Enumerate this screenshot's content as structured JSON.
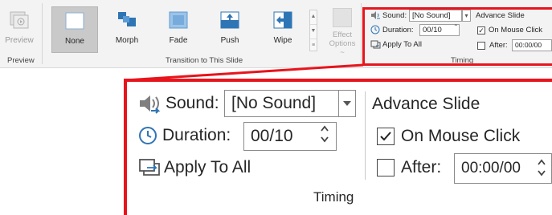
{
  "ribbon": {
    "preview": {
      "button_label": "Preview",
      "group_label": "Preview"
    },
    "transitions": [
      {
        "label": "None",
        "selected": true
      },
      {
        "label": "Morph"
      },
      {
        "label": "Fade"
      },
      {
        "label": "Push"
      },
      {
        "label": "Wipe"
      }
    ],
    "effect_options": {
      "line1": "Effect",
      "line2": "Options ~"
    },
    "transition_group_label": "Transition to This Slide",
    "timing": {
      "sound_label": "Sound:",
      "sound_value": "[No Sound]",
      "duration_label": "Duration:",
      "duration_value": "00/10",
      "apply_to_all": "Apply To All",
      "advance_slide": "Advance Slide",
      "on_mouse_click": "On Mouse Click",
      "on_mouse_click_checked": true,
      "after_label": "After:",
      "after_value": "00:00/00",
      "after_checked": false,
      "group_label": "Timing"
    }
  },
  "zoom": {
    "sound_label": "Sound:",
    "sound_value": "[No Sound]",
    "duration_label": "Duration:",
    "duration_value": "00/10",
    "apply_to_all": "Apply To All",
    "advance_slide": "Advance Slide",
    "on_mouse_click": "On Mouse Click",
    "on_mouse_click_checked": true,
    "after_label": "After:",
    "after_value": "00:00/00",
    "after_checked": false,
    "group_label": "Timing"
  },
  "colors": {
    "highlight": "#e8141c",
    "ribbon_bg": "#f3f3f3",
    "selected_bg": "#c9c9c9",
    "icon_blue": "#2e75b6"
  }
}
